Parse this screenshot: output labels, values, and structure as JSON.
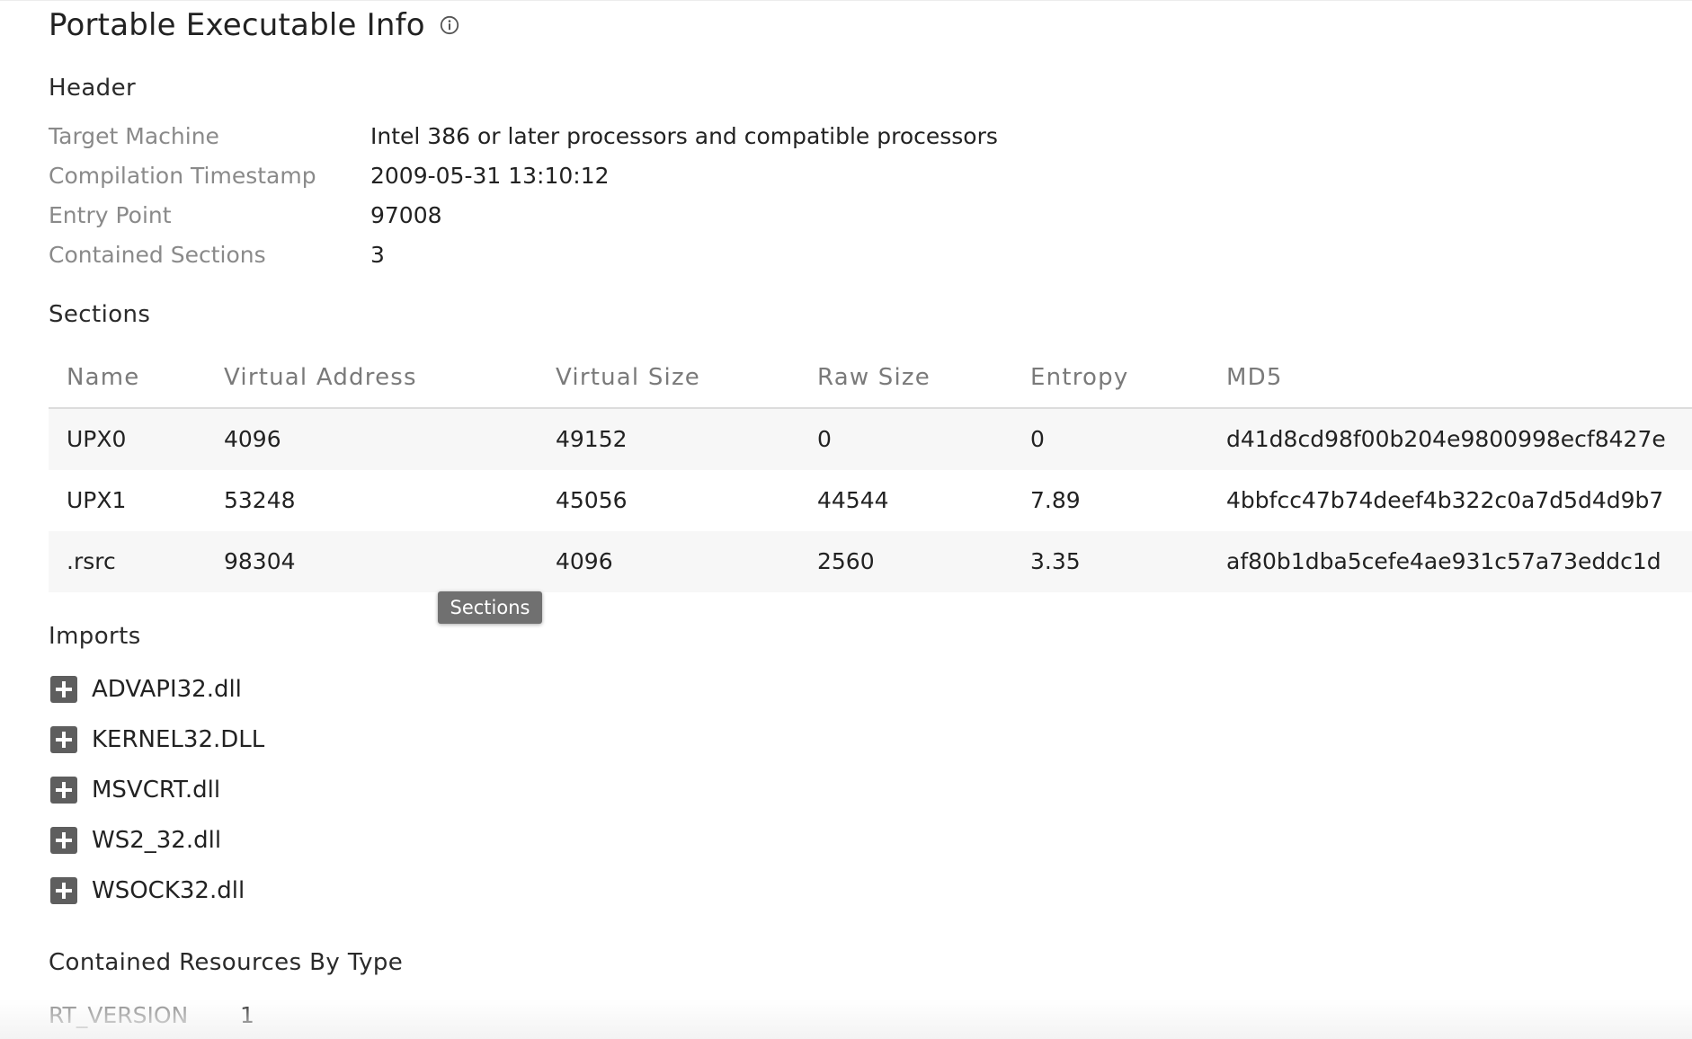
{
  "title": "Portable Executable Info",
  "header": {
    "heading": "Header",
    "rows": [
      {
        "label": "Target Machine",
        "value": "Intel 386 or later processors and compatible processors"
      },
      {
        "label": "Compilation Timestamp",
        "value": "2009-05-31 13:10:12"
      },
      {
        "label": "Entry Point",
        "value": "97008"
      },
      {
        "label": "Contained Sections",
        "value": "3"
      }
    ]
  },
  "sections": {
    "heading": "Sections",
    "columns": [
      "Name",
      "Virtual Address",
      "Virtual Size",
      "Raw Size",
      "Entropy",
      "MD5"
    ],
    "rows": [
      [
        "UPX0",
        "4096",
        "49152",
        "0",
        "0",
        "d41d8cd98f00b204e9800998ecf8427e"
      ],
      [
        "UPX1",
        "53248",
        "45056",
        "44544",
        "7.89",
        "4bbfcc47b74deef4b322c0a7d5d4d9b7"
      ],
      [
        ".rsrc",
        "98304",
        "4096",
        "2560",
        "3.35",
        "af80b1dba5cefe4ae931c57a73eddc1d"
      ]
    ],
    "tooltip": "Sections"
  },
  "imports": {
    "heading": "Imports",
    "items": [
      "ADVAPI32.dll",
      "KERNEL32.DLL",
      "MSVCRT.dll",
      "WS2_32.dll",
      "WSOCK32.dll"
    ]
  },
  "resources": {
    "heading": "Contained Resources By Type",
    "rows": [
      {
        "label": "RT_VERSION",
        "value": "1"
      }
    ]
  },
  "icons": {
    "info": "info-circle-icon",
    "expand": "plus-square-icon"
  },
  "colors": {
    "label_gray": "#8a8a8a",
    "icon_gray": "#5e5e5e",
    "tooltip_bg": "#707070",
    "row_shade": "#f7f7f7"
  }
}
